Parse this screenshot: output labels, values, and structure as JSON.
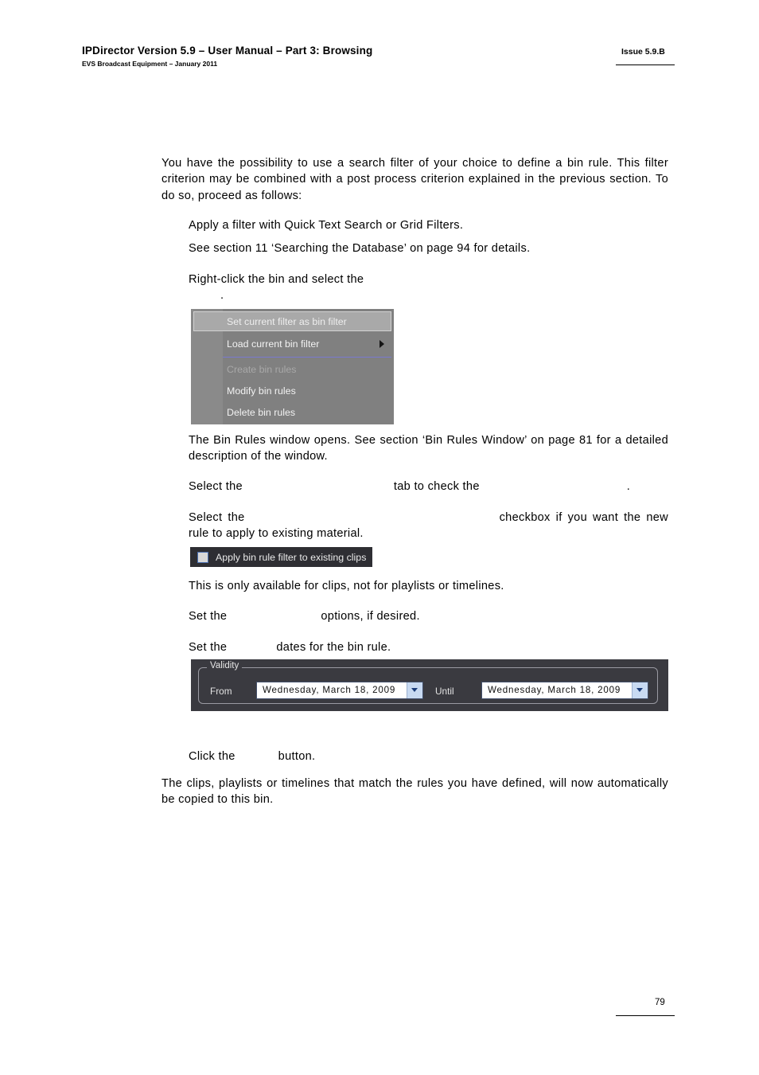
{
  "header": {
    "title": "IPDirector Version 5.9 – User Manual – Part 3: Browsing",
    "subtitle": "EVS Broadcast Equipment – January 2011",
    "issue": "Issue 5.9.B"
  },
  "footer": {
    "page_number": "79"
  },
  "body": {
    "intro": "You have the possibility to use a search filter of your choice to define a bin rule. This filter criterion may be combined with a post process criterion explained in the previous section. To do so, proceed as follows:",
    "step_apply_filter": "Apply a filter with Quick Text Search or Grid Filters.",
    "step_see_section": "See section 11 ‘Searching the Database’ on page 94 for details.",
    "step_rightclick_pre": "Right-click the bin and select the",
    "step_rightclick_end": ".",
    "bin_rules_window": "The Bin Rules window opens. See section ‘Bin Rules Window’ on page 81 for a detailed description of the window.",
    "step_select_tab_pre": "Select the",
    "step_select_tab_mid": "tab to check the",
    "step_select_tab_end": ".",
    "step_checkbox_pre": "Select the",
    "step_checkbox_post": "checkbox if you want the new rule to apply to existing material.",
    "note_clips_only": "This is only available for clips, not for playlists or timelines.",
    "step_options_pre": "Set the",
    "step_options_post": "options, if desired.",
    "step_dates_pre": "Set the",
    "step_dates_post": "dates for the bin rule.",
    "step_click_pre": "Click the",
    "step_click_post": "button.",
    "closing": "The clips, playlists or timelines that match the rules you have defined, will now automatically be copied to this bin."
  },
  "context_menu": {
    "items": [
      {
        "label": "Set current filter as bin filter",
        "state": "highlighted",
        "submenu": false
      },
      {
        "label": "Load current bin filter",
        "state": "normal",
        "submenu": true
      },
      {
        "label": "Create bin rules",
        "state": "disabled",
        "submenu": false
      },
      {
        "label": "Modify bin rules",
        "state": "normal",
        "submenu": false
      },
      {
        "label": "Delete bin rules",
        "state": "normal",
        "submenu": false
      }
    ],
    "colors": {
      "background": "#808080",
      "highlight": "#a9a9a9",
      "separator": "#7a7ad0",
      "disabled_text": "#a8a8a8"
    }
  },
  "checkbox_shot": {
    "label": "Apply bin rule filter to existing clips",
    "checked": false,
    "background": "#2e2e33",
    "box_border": "#4a6fb0"
  },
  "validity_panel": {
    "legend": "Validity",
    "from_label": "From",
    "until_label": "Until",
    "from_value": "Wednesday,    March    18, 2009",
    "until_value": "Wednesday,    March    18, 2009",
    "background": "#3a3a40",
    "accent": "#c8daf2"
  }
}
